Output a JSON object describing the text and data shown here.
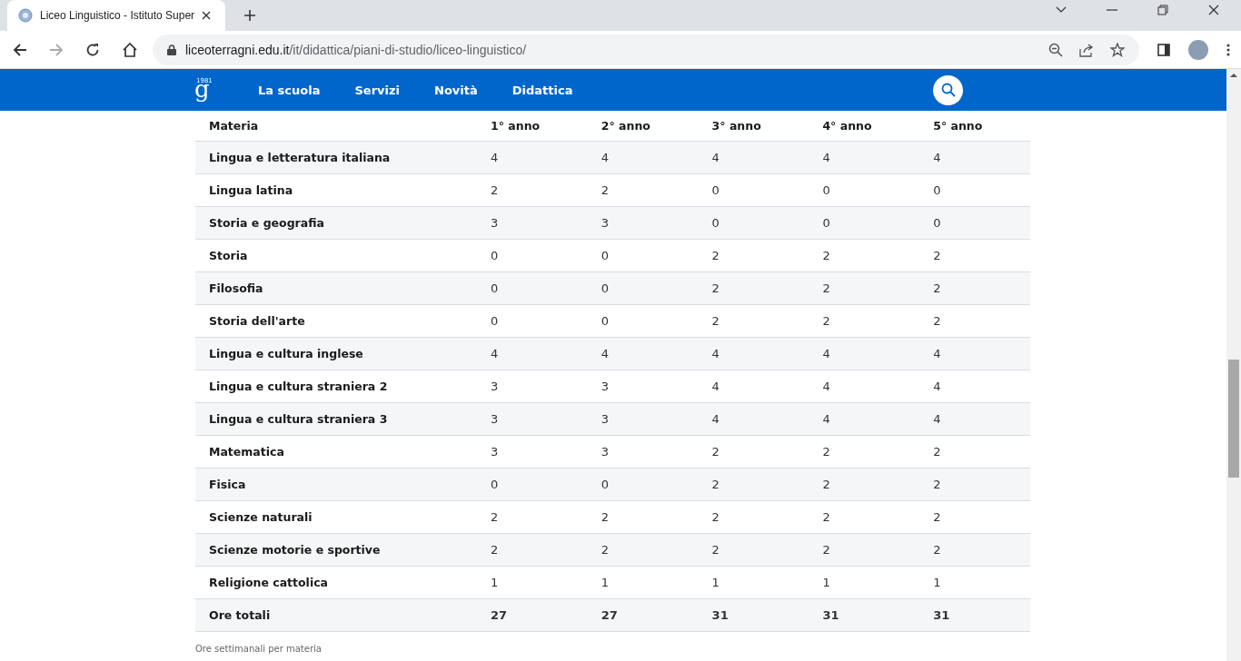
{
  "browser": {
    "tab_title": "Liceo Linguistico - Istituto Super",
    "url_domain": "liceoterragni.edu.it",
    "url_path": "/it/didattica/piani-di-studio/liceo-linguistico/"
  },
  "nav": {
    "logo_letter": "g",
    "logo_text": "1981",
    "items": [
      "La scuola",
      "Servizi",
      "Novità",
      "Didattica"
    ]
  },
  "table": {
    "columns": [
      "Materia",
      "1° anno",
      "2° anno",
      "3° anno",
      "4° anno",
      "5° anno"
    ],
    "rows": [
      {
        "kind": "subject",
        "cells": [
          "Lingua e letteratura italiana",
          "4",
          "4",
          "4",
          "4",
          "4"
        ]
      },
      {
        "kind": "subject",
        "cells": [
          "Lingua latina",
          "2",
          "2",
          "0",
          "0",
          "0"
        ]
      },
      {
        "kind": "subject",
        "cells": [
          "Storia e geografia",
          "3",
          "3",
          "0",
          "0",
          "0"
        ]
      },
      {
        "kind": "subject",
        "cells": [
          "Storia",
          "0",
          "0",
          "2",
          "2",
          "2"
        ]
      },
      {
        "kind": "subject",
        "cells": [
          "Filosofia",
          "0",
          "0",
          "2",
          "2",
          "2"
        ]
      },
      {
        "kind": "subject",
        "cells": [
          "Storia dell'arte",
          "0",
          "0",
          "2",
          "2",
          "2"
        ]
      },
      {
        "kind": "subject",
        "cells": [
          "Lingua e cultura inglese",
          "4",
          "4",
          "4",
          "4",
          "4"
        ]
      },
      {
        "kind": "subject",
        "cells": [
          "Lingua e cultura straniera 2",
          "3",
          "3",
          "4",
          "4",
          "4"
        ]
      },
      {
        "kind": "subject",
        "cells": [
          "Lingua e cultura straniera 3",
          "3",
          "3",
          "4",
          "4",
          "4"
        ]
      },
      {
        "kind": "subject",
        "cells": [
          "Matematica",
          "3",
          "3",
          "2",
          "2",
          "2"
        ]
      },
      {
        "kind": "subject",
        "cells": [
          "Fisica",
          "0",
          "0",
          "2",
          "2",
          "2"
        ]
      },
      {
        "kind": "subject",
        "cells": [
          "Scienze naturali",
          "2",
          "2",
          "2",
          "2",
          "2"
        ]
      },
      {
        "kind": "subject",
        "cells": [
          "Scienze motorie e sportive",
          "2",
          "2",
          "2",
          "2",
          "2"
        ]
      },
      {
        "kind": "subject",
        "cells": [
          "Religione cattolica",
          "1",
          "1",
          "1",
          "1",
          "1"
        ]
      },
      {
        "kind": "total",
        "cells": [
          "Ore totali",
          "27",
          "27",
          "31",
          "31",
          "31"
        ]
      }
    ],
    "caption": "Ore settimanali per materia"
  }
}
